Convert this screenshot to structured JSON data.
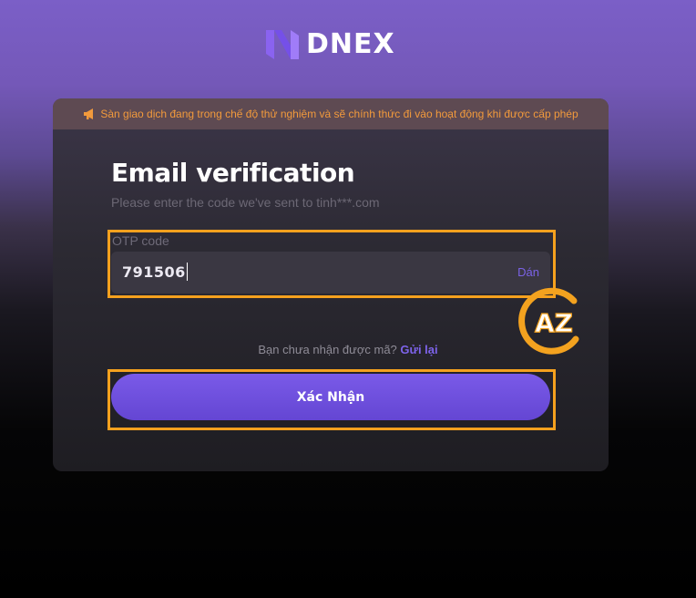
{
  "brand": {
    "name": "DNEX",
    "logo_icon": "dnex-logo-icon"
  },
  "banner": {
    "icon": "megaphone-icon",
    "text": "Sàn giao dịch đang trong chế độ thử nghiệm và sẽ chính thức đi vào hoạt động khi được cấp phép",
    "color": "#f29a3c"
  },
  "verification": {
    "title": "Email verification",
    "subtitle": "Please enter the code we've sent to tinh***.com"
  },
  "otp": {
    "label": "OTP code",
    "value": "791506",
    "paste_label": "Dán"
  },
  "resend": {
    "prompt": "Bạn chưa nhận được mã?",
    "link_label": "Gửi lại"
  },
  "confirm_button": {
    "label": "Xác Nhận"
  },
  "watermark": {
    "text": "AZ"
  },
  "colors": {
    "accent": "#7b5ce6",
    "highlight": "#f5a11e",
    "warning": "#f29a3c"
  }
}
